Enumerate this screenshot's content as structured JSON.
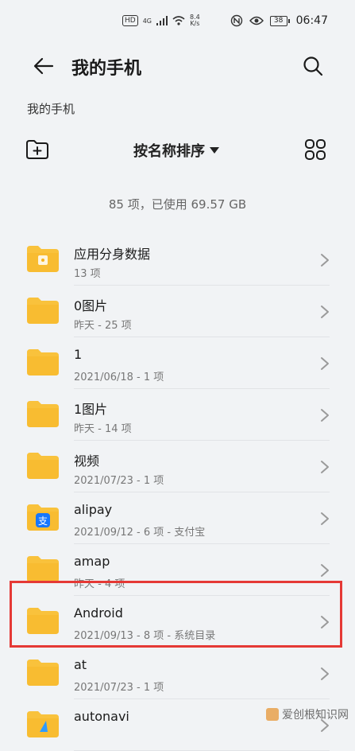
{
  "status_bar": {
    "hd": "HD",
    "network": "4G",
    "speed_value": "8.4",
    "speed_unit": "K/s",
    "battery": "38",
    "time": "06:47"
  },
  "header": {
    "title": "我的手机"
  },
  "breadcrumb": "我的手机",
  "toolbar": {
    "sort_label": "按名称排序"
  },
  "summary": "85 项，已使用 69.57 GB",
  "files": [
    {
      "name": "应用分身数据",
      "meta": "13 项",
      "icon": "app-clone-folder-icon"
    },
    {
      "name": "0图片",
      "meta": "昨天 - 25 项",
      "icon": "folder-icon"
    },
    {
      "name": "1",
      "meta": "2021/06/18 - 1 项",
      "icon": "folder-icon"
    },
    {
      "name": "1图片",
      "meta": "昨天 - 14 项",
      "icon": "folder-icon"
    },
    {
      "name": "视频",
      "meta": "2021/07/23 - 1 项",
      "icon": "folder-icon"
    },
    {
      "name": "alipay",
      "meta": "2021/09/12 - 6 项 - 支付宝",
      "icon": "alipay-folder-icon"
    },
    {
      "name": "amap",
      "meta": "昨天 - 4 项",
      "icon": "folder-icon"
    },
    {
      "name": "Android",
      "meta": "2021/09/13 - 8 项 - 系统目录",
      "icon": "folder-icon"
    },
    {
      "name": "at",
      "meta": "2021/07/23 - 1 项",
      "icon": "folder-icon"
    },
    {
      "name": "autonavi",
      "meta": "",
      "icon": "autonavi-folder-icon"
    }
  ],
  "colors": {
    "folder": "#f9c23c",
    "folder_dark": "#f5b21d",
    "highlight": "#e53935"
  },
  "watermark": "爱创根知识网"
}
